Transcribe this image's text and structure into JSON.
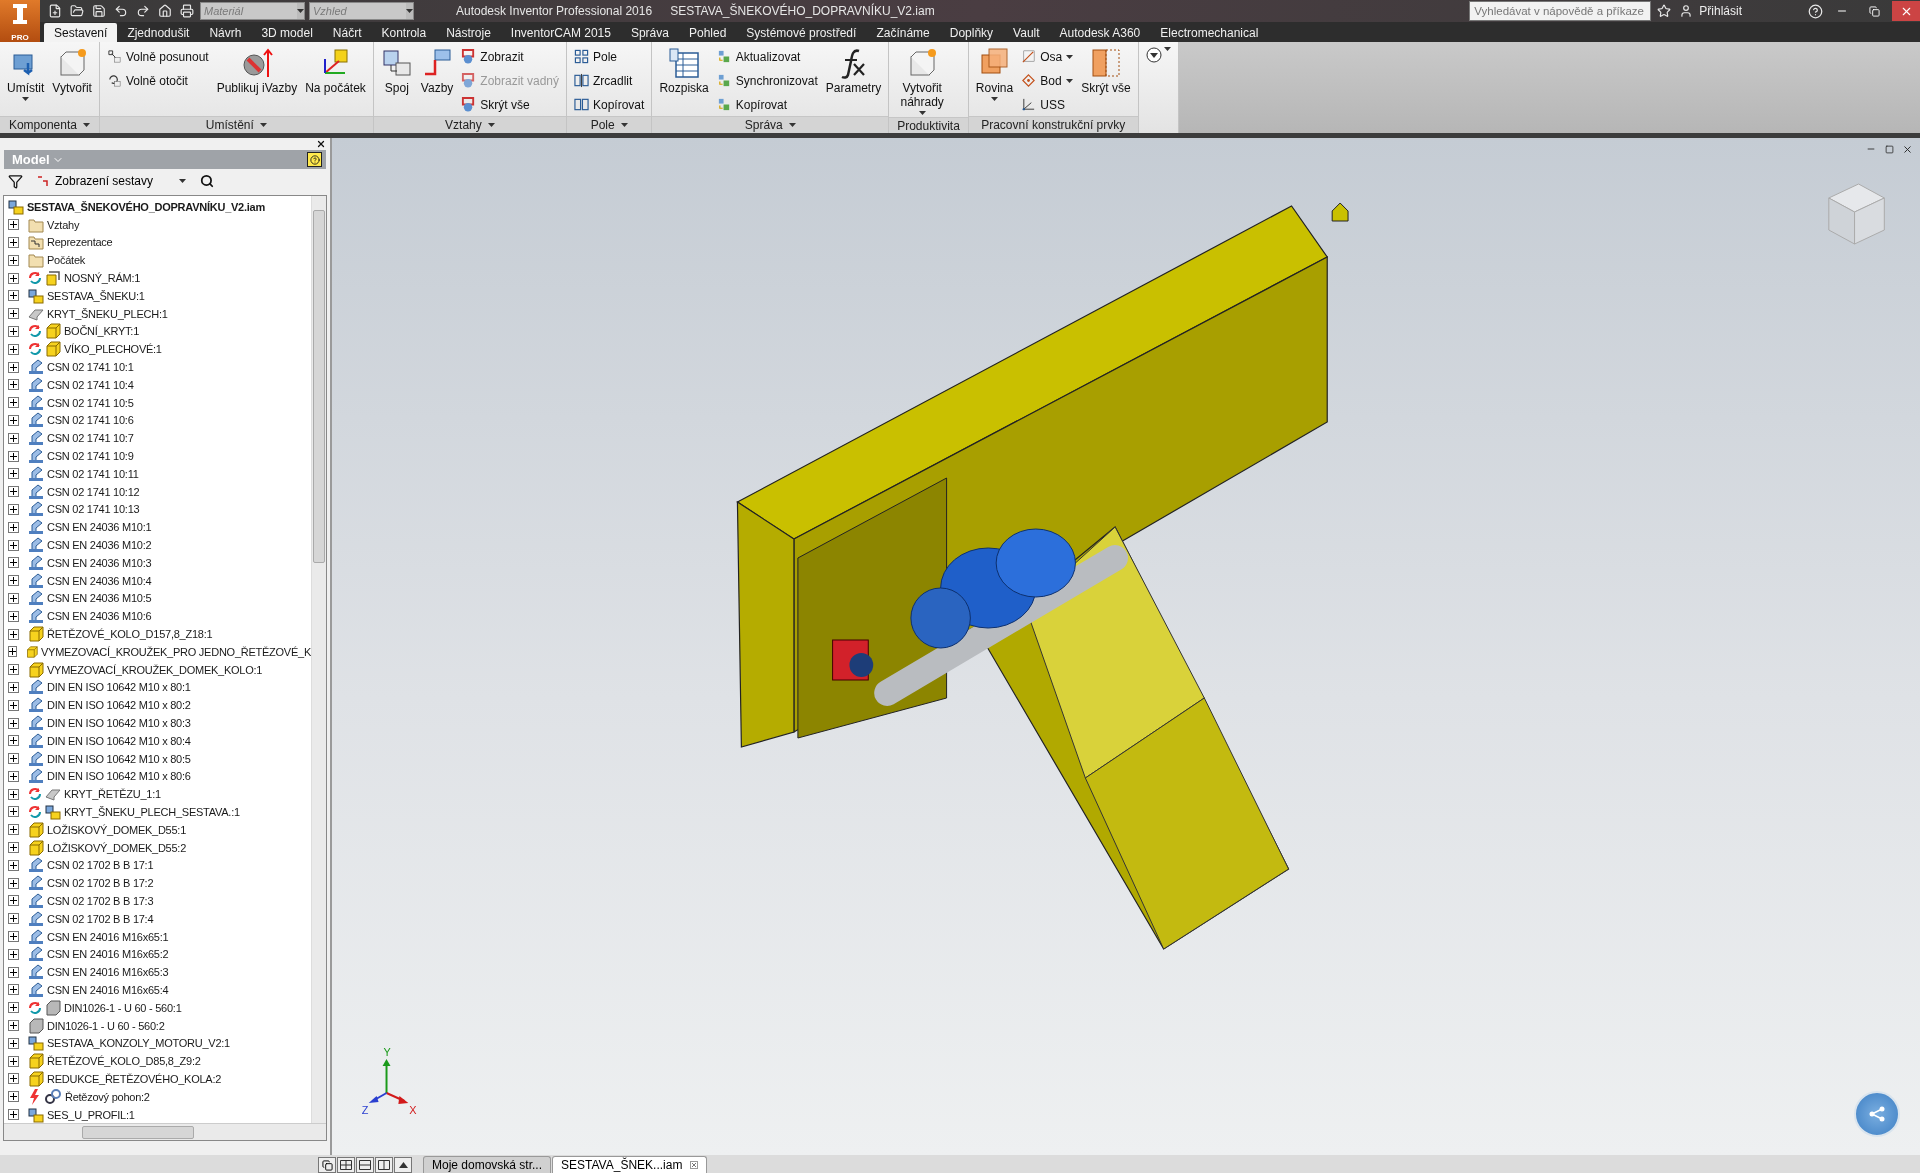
{
  "app_button": {
    "label": "PRO"
  },
  "quick_access": {
    "material": {
      "placeholder": "Materiál"
    },
    "appearance": {
      "placeholder": "Vzhled"
    }
  },
  "title": "Autodesk Inventor Professional 2016",
  "document": "SESTAVA_ŠNEKOVÉHO_DOPRAVNÍKU_V2.iam",
  "search": {
    "placeholder": "Vyhledávat v nápovědě a příkaze"
  },
  "sign_in": "Přihlásit",
  "tabs": [
    {
      "label": "Sestavení",
      "selected": true
    },
    {
      "label": "Zjednodušit",
      "selected": false
    },
    {
      "label": "Návrh",
      "selected": false
    },
    {
      "label": "3D model",
      "selected": false
    },
    {
      "label": "Náčrt",
      "selected": false
    },
    {
      "label": "Kontrola",
      "selected": false
    },
    {
      "label": "Nástroje",
      "selected": false
    },
    {
      "label": "InventorCAM 2015",
      "selected": false
    },
    {
      "label": "Správa",
      "selected": false
    },
    {
      "label": "Pohled",
      "selected": false
    },
    {
      "label": "Systémové prostředí",
      "selected": false
    },
    {
      "label": "Začínáme",
      "selected": false
    },
    {
      "label": "Doplňky",
      "selected": false
    },
    {
      "label": "Vault",
      "selected": false
    },
    {
      "label": "Autodesk A360",
      "selected": false
    },
    {
      "label": "Electromechanical",
      "selected": false
    }
  ],
  "ribbon": [
    {
      "title": "Komponenta",
      "menu": true,
      "groups": [
        {
          "kind": "large",
          "label": "Umístit",
          "dropdown": true
        },
        {
          "kind": "large",
          "label": "Vytvořit",
          "dropdown": false
        }
      ]
    },
    {
      "title": "Umístění",
      "menu": true,
      "groups": [
        {
          "kind": "stack",
          "items": [
            {
              "label": "Volně posunout",
              "disabled": false,
              "dropdown": false
            },
            {
              "label": "Volně otočit",
              "disabled": false,
              "dropdown": false
            }
          ]
        },
        {
          "kind": "large",
          "label": "Publikuj iVazby",
          "dropdown": false
        },
        {
          "kind": "large",
          "label": "Na počátek",
          "dropdown": false
        }
      ]
    },
    {
      "title": "Vztahy",
      "menu": true,
      "groups": [
        {
          "kind": "large",
          "label": "Spoj",
          "dropdown": false
        },
        {
          "kind": "large",
          "label": "Vazby",
          "dropdown": false
        },
        {
          "kind": "stack",
          "items": [
            {
              "label": "Zobrazit",
              "disabled": false,
              "dropdown": false
            },
            {
              "label": "Zobrazit vadný",
              "disabled": true,
              "dropdown": false
            },
            {
              "label": "Skrýt vše",
              "disabled": false,
              "dropdown": false
            }
          ]
        }
      ]
    },
    {
      "title": "Pole",
      "menu": true,
      "groups": [
        {
          "kind": "stack",
          "items": [
            {
              "label": "Pole",
              "disabled": false,
              "dropdown": false
            },
            {
              "label": "Zrcadlit",
              "disabled": false,
              "dropdown": false
            },
            {
              "label": "Kopírovat",
              "disabled": false,
              "dropdown": false
            }
          ]
        }
      ]
    },
    {
      "title": "Správa",
      "menu": true,
      "groups": [
        {
          "kind": "large",
          "label": "Rozpiska",
          "dropdown": false
        },
        {
          "kind": "stack",
          "items": [
            {
              "label": "Aktualizovat",
              "disabled": false,
              "dropdown": false
            },
            {
              "label": "Synchronizovat",
              "disabled": false,
              "dropdown": false
            },
            {
              "label": "Kopírovat",
              "disabled": false,
              "dropdown": false
            }
          ]
        },
        {
          "kind": "large",
          "label": "Parametry",
          "dropdown": false
        }
      ]
    },
    {
      "title": "Produktivita",
      "menu": false,
      "groups": [
        {
          "kind": "large",
          "label": "Vytvořit náhrady",
          "dropdown": true
        }
      ]
    },
    {
      "title": "Pracovní konstrukční prvky",
      "menu": false,
      "groups": [
        {
          "kind": "large",
          "label": "Rovina",
          "dropdown": true
        },
        {
          "kind": "stack",
          "items": [
            {
              "label": "Osa",
              "disabled": false,
              "dropdown": true
            },
            {
              "label": "Bod",
              "disabled": false,
              "dropdown": true
            },
            {
              "label": "USS",
              "disabled": false,
              "dropdown": false
            }
          ]
        },
        {
          "kind": "large",
          "label": "Skrýt vše",
          "dropdown": false
        }
      ]
    }
  ],
  "browser": {
    "title": "Model",
    "view": "Zobrazení sestavy",
    "root": {
      "label": "SESTAVA_ŠNEKOVÉHO_DOPRAVNÍKU_V2.iam",
      "kind": "assembly"
    },
    "items": [
      {
        "label": "Vztahy",
        "kind": "folder",
        "needs_update": false
      },
      {
        "label": "Reprezentace",
        "kind": "representation",
        "needs_update": false
      },
      {
        "label": "Počátek",
        "kind": "folder",
        "needs_update": false
      },
      {
        "label": "NOSNÝ_RÁM:1",
        "kind": "weldment",
        "needs_update": true
      },
      {
        "label": "SESTAVA_ŠNEKU:1",
        "kind": "assembly",
        "needs_update": false
      },
      {
        "label": "KRYT_ŠNEKU_PLECH:1",
        "kind": "sheetmetal",
        "needs_update": false
      },
      {
        "label": "BOČNÍ_KRYT:1",
        "kind": "part",
        "needs_update": true
      },
      {
        "label": "VÍKO_PLECHOVÉ:1",
        "kind": "part",
        "needs_update": true
      },
      {
        "label": "CSN 02 1741 10:1",
        "kind": "standard",
        "needs_update": false
      },
      {
        "label": "CSN 02 1741 10:4",
        "kind": "standard",
        "needs_update": false
      },
      {
        "label": "CSN 02 1741 10:5",
        "kind": "standard",
        "needs_update": false
      },
      {
        "label": "CSN 02 1741 10:6",
        "kind": "standard",
        "needs_update": false
      },
      {
        "label": "CSN 02 1741 10:7",
        "kind": "standard",
        "needs_update": false
      },
      {
        "label": "CSN 02 1741 10:9",
        "kind": "standard",
        "needs_update": false
      },
      {
        "label": "CSN 02 1741 10:11",
        "kind": "standard",
        "needs_update": false
      },
      {
        "label": "CSN 02 1741 10:12",
        "kind": "standard",
        "needs_update": false
      },
      {
        "label": "CSN 02 1741 10:13",
        "kind": "standard",
        "needs_update": false
      },
      {
        "label": "CSN EN 24036 M10:1",
        "kind": "standard",
        "needs_update": false
      },
      {
        "label": "CSN EN 24036 M10:2",
        "kind": "standard",
        "needs_update": false
      },
      {
        "label": "CSN EN 24036 M10:3",
        "kind": "standard",
        "needs_update": false
      },
      {
        "label": "CSN EN 24036 M10:4",
        "kind": "standard",
        "needs_update": false
      },
      {
        "label": "CSN EN 24036 M10:5",
        "kind": "standard",
        "needs_update": false
      },
      {
        "label": "CSN EN 24036 M10:6",
        "kind": "standard",
        "needs_update": false
      },
      {
        "label": "ŘETĚZOVÉ_KOLO_D157,8_Z18:1",
        "kind": "part",
        "needs_update": false
      },
      {
        "label": "VYMEZOVACÍ_KROUŽEK_PRO JEDNO_ŘETĚZOVÉ_K",
        "kind": "part",
        "needs_update": false
      },
      {
        "label": "VYMEZOVACÍ_KROUŽEK_DOMEK_KOLO:1",
        "kind": "part",
        "needs_update": false
      },
      {
        "label": "DIN EN ISO 10642 M10  x  80:1",
        "kind": "standard",
        "needs_update": false
      },
      {
        "label": "DIN EN ISO 10642 M10  x  80:2",
        "kind": "standard",
        "needs_update": false
      },
      {
        "label": "DIN EN ISO 10642 M10  x  80:3",
        "kind": "standard",
        "needs_update": false
      },
      {
        "label": "DIN EN ISO 10642 M10  x  80:4",
        "kind": "standard",
        "needs_update": false
      },
      {
        "label": "DIN EN ISO 10642 M10  x  80:5",
        "kind": "standard",
        "needs_update": false
      },
      {
        "label": "DIN EN ISO 10642 M10  x  80:6",
        "kind": "standard",
        "needs_update": false
      },
      {
        "label": "KRYT_ŘETĚZU_1:1",
        "kind": "sheetmetal",
        "needs_update": true
      },
      {
        "label": "KRYT_ŠNEKU_PLECH_SESTAVA.:1",
        "kind": "assembly",
        "needs_update": true
      },
      {
        "label": "LOŽISKOVÝ_DOMEK_D55:1",
        "kind": "part",
        "needs_update": false
      },
      {
        "label": "LOŽISKOVÝ_DOMEK_D55:2",
        "kind": "part",
        "needs_update": false
      },
      {
        "label": "CSN 02 1702 B B 17:1",
        "kind": "standard",
        "needs_update": false
      },
      {
        "label": "CSN 02 1702 B B 17:2",
        "kind": "standard",
        "needs_update": false
      },
      {
        "label": "CSN 02 1702 B B 17:3",
        "kind": "standard",
        "needs_update": false
      },
      {
        "label": "CSN 02 1702 B B 17:4",
        "kind": "standard",
        "needs_update": false
      },
      {
        "label": "CSN EN 24016 M16x65:1",
        "kind": "standard",
        "needs_update": false
      },
      {
        "label": "CSN EN 24016 M16x65:2",
        "kind": "standard",
        "needs_update": false
      },
      {
        "label": "CSN EN 24016 M16x65:3",
        "kind": "standard",
        "needs_update": false
      },
      {
        "label": "CSN EN 24016 M16x65:4",
        "kind": "standard",
        "needs_update": false
      },
      {
        "label": "DIN1026-1 - U 60 - 560:1",
        "kind": "frame",
        "needs_update": true
      },
      {
        "label": "DIN1026-1 - U 60 - 560:2",
        "kind": "frame",
        "needs_update": false
      },
      {
        "label": "SESTAVA_KONZOLY_MOTORU_V2:1",
        "kind": "assembly",
        "needs_update": false
      },
      {
        "label": "ŘETĚZOVÉ_KOLO_D85,8_Z9:2",
        "kind": "part",
        "needs_update": false
      },
      {
        "label": "REDUKCE_ŘETĚZOVÉHO_KOLA:2",
        "kind": "part",
        "needs_update": false
      },
      {
        "label": "Řetězový pohon:2",
        "kind": "chain",
        "needs_update": false
      },
      {
        "label": "SES_U_PROFIL:1",
        "kind": "assembly",
        "needs_update": false
      }
    ]
  },
  "viewport": {
    "axes": [
      "X",
      "Y",
      "Z"
    ]
  },
  "doc_tabs": [
    {
      "label": "Moje domovská str...",
      "selected": false,
      "closable": false
    },
    {
      "label": "SESTAVA_ŠNEK...iam",
      "selected": true,
      "closable": true
    }
  ]
}
